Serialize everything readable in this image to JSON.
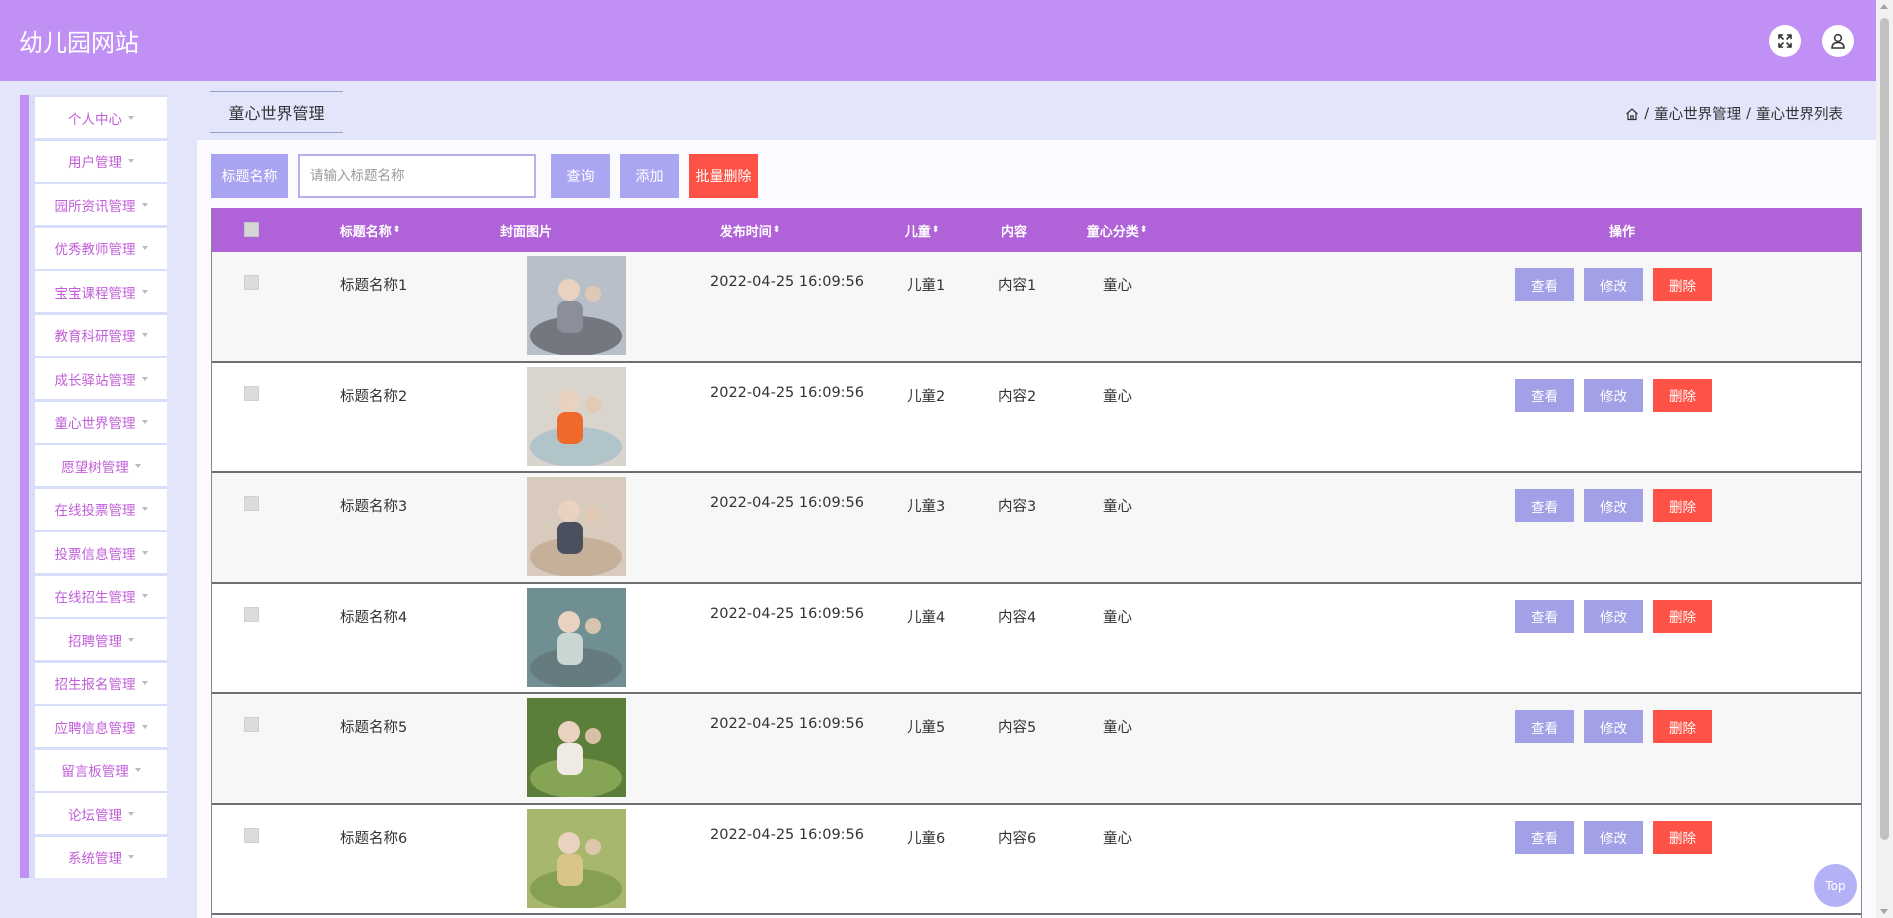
{
  "header": {
    "title": "幼儿园网站",
    "icons": [
      "fullscreen-icon",
      "user-icon"
    ]
  },
  "sidebar": {
    "items": [
      {
        "label": "个人中心"
      },
      {
        "label": "用户管理"
      },
      {
        "label": "园所资讯管理"
      },
      {
        "label": "优秀教师管理"
      },
      {
        "label": "宝宝课程管理"
      },
      {
        "label": "教育科研管理"
      },
      {
        "label": "成长驿站管理"
      },
      {
        "label": "童心世界管理"
      },
      {
        "label": "愿望树管理"
      },
      {
        "label": "在线投票管理"
      },
      {
        "label": "投票信息管理"
      },
      {
        "label": "在线招生管理"
      },
      {
        "label": "招聘管理"
      },
      {
        "label": "招生报名管理"
      },
      {
        "label": "应聘信息管理"
      },
      {
        "label": "留言板管理"
      },
      {
        "label": "论坛管理"
      },
      {
        "label": "系统管理"
      }
    ]
  },
  "page": {
    "tab_title": "童心世界管理"
  },
  "breadcrumb": {
    "home_icon": "home-icon",
    "sep": "/",
    "level1": "童心世界管理",
    "level2": "童心世界列表"
  },
  "search": {
    "label": "标题名称",
    "placeholder": "请输入标题名称",
    "query_label": "查询",
    "add_label": "添加",
    "batch_delete_label": "批量删除"
  },
  "table": {
    "headers": {
      "title": "标题名称",
      "cover": "封面图片",
      "publish_time": "发布时间",
      "child": "儿童",
      "content": "内容",
      "category": "童心分类",
      "actions": "操作"
    },
    "actions": {
      "view": "查看",
      "edit": "修改",
      "delete": "删除"
    },
    "rows": [
      {
        "title": "标题名称1",
        "publish_time": "2022-04-25 16:09:56",
        "child": "儿童1",
        "content": "内容1",
        "category": "童心"
      },
      {
        "title": "标题名称2",
        "publish_time": "2022-04-25 16:09:56",
        "child": "儿童2",
        "content": "内容2",
        "category": "童心"
      },
      {
        "title": "标题名称3",
        "publish_time": "2022-04-25 16:09:56",
        "child": "儿童3",
        "content": "内容3",
        "category": "童心"
      },
      {
        "title": "标题名称4",
        "publish_time": "2022-04-25 16:09:56",
        "child": "儿童4",
        "content": "内容4",
        "category": "童心"
      },
      {
        "title": "标题名称5",
        "publish_time": "2022-04-25 16:09:56",
        "child": "儿童5",
        "content": "内容5",
        "category": "童心"
      },
      {
        "title": "标题名称6",
        "publish_time": "2022-04-25 16:09:56",
        "child": "儿童6",
        "content": "内容6",
        "category": "童心"
      }
    ]
  },
  "top_button": {
    "label": "Top"
  },
  "colors": {
    "header": "#c090f5",
    "accent": "#aaa6f2",
    "danger": "#fd5245",
    "table_header": "#b062d8",
    "sidebar_text": "#c25ed8"
  }
}
